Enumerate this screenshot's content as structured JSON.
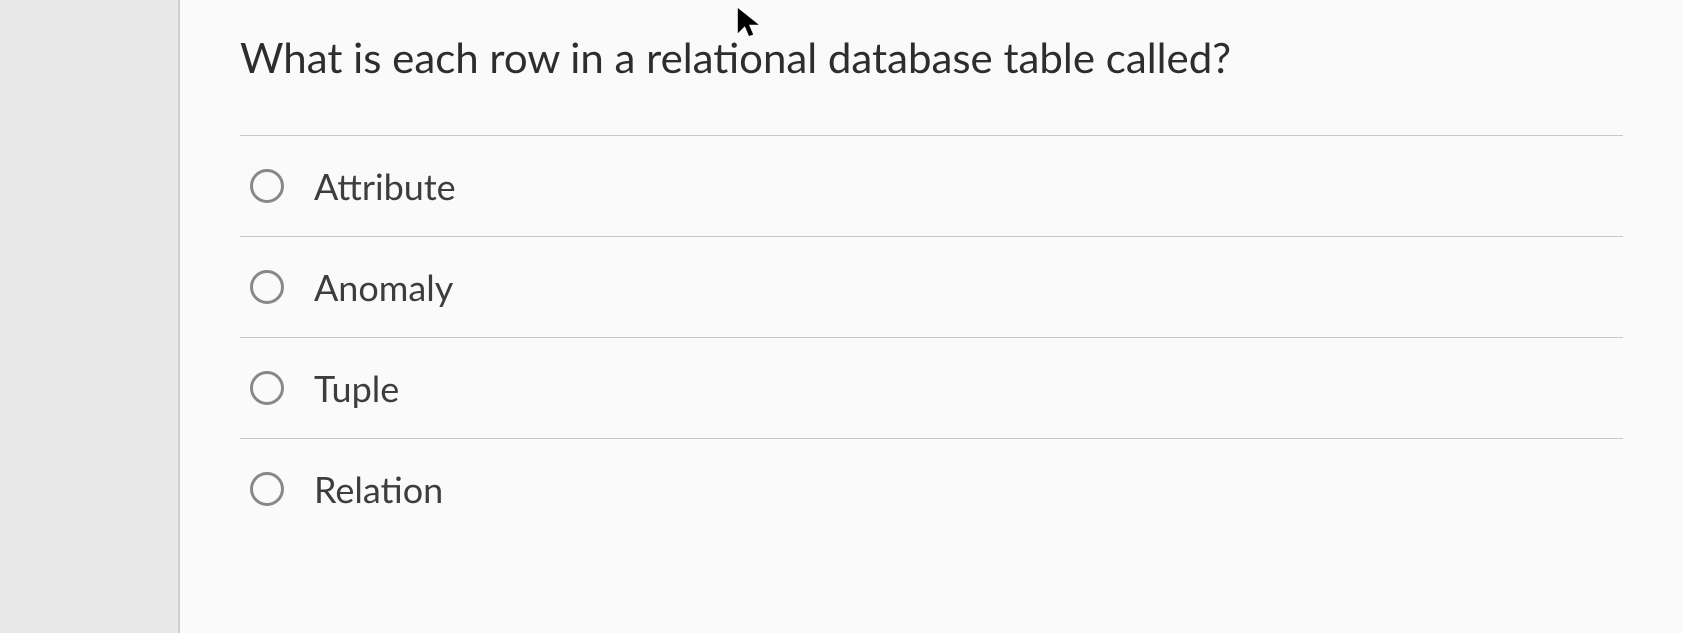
{
  "question": {
    "prompt": "What is each row in a relational database table called?",
    "options": [
      {
        "label": "Attribute",
        "selected": false
      },
      {
        "label": "Anomaly",
        "selected": false
      },
      {
        "label": "Tuple",
        "selected": false
      },
      {
        "label": "Relation",
        "selected": false
      }
    ]
  }
}
